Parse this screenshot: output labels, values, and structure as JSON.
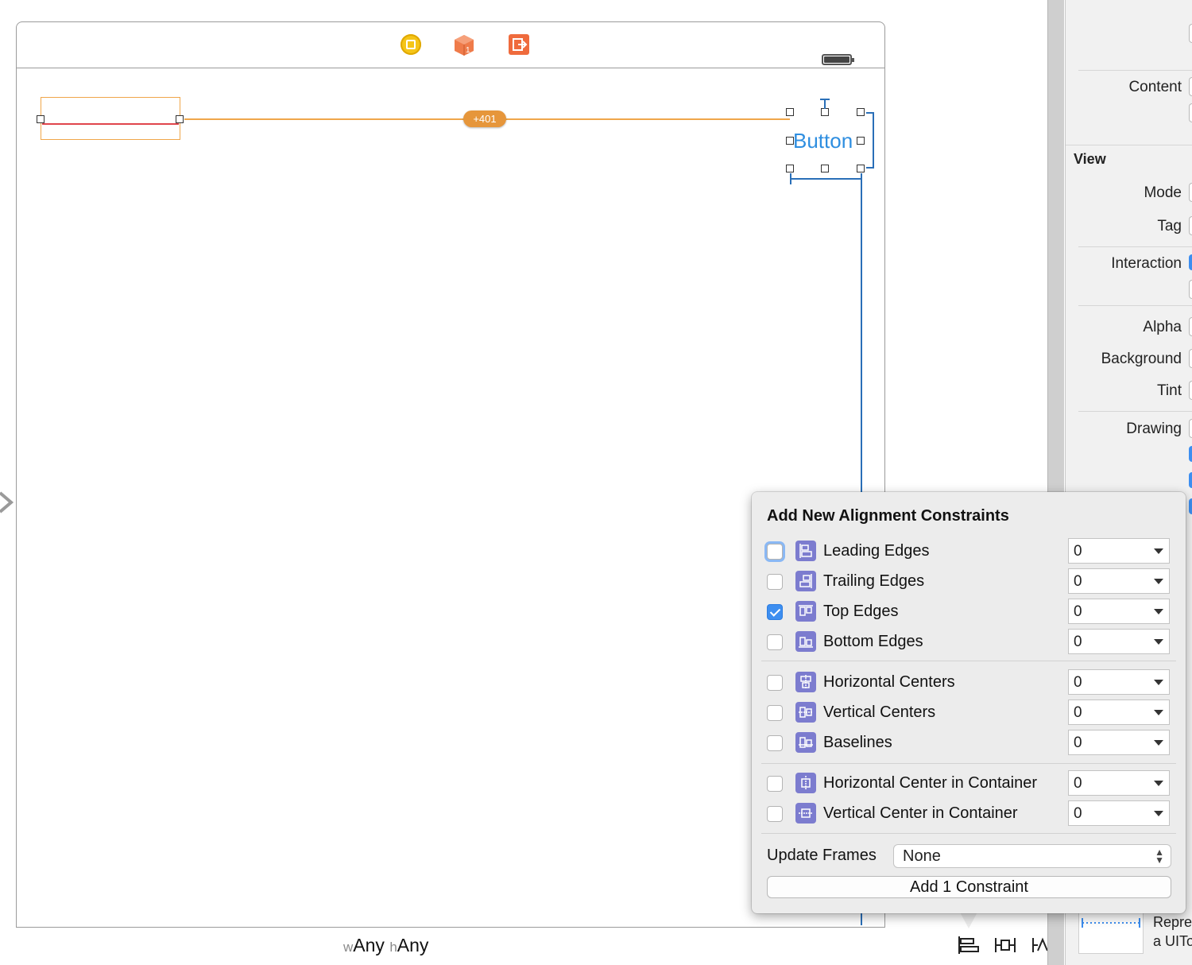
{
  "canvas": {
    "constraint_badge": "+401",
    "button_title": "Button",
    "size_class": {
      "w_prefix": "w",
      "w_value": "Any",
      "h_prefix": "h",
      "h_value": "Any"
    }
  },
  "inspector": {
    "content_label": "Content",
    "view_header": "View",
    "mode_label": "Mode",
    "tag_label": "Tag",
    "interaction_label": "Interaction",
    "alpha_label": "Alpha",
    "background_label": "Background",
    "tint_label": "Tint",
    "drawing_label": "Drawing",
    "library_text_1": "Repre",
    "library_text_2": "a UITo"
  },
  "popover": {
    "title": "Add New Alignment Constraints",
    "rows": [
      {
        "label": "Leading Edges",
        "checked": false,
        "value": "0",
        "icon": "leading-edges-icon"
      },
      {
        "label": "Trailing Edges",
        "checked": false,
        "value": "0",
        "icon": "trailing-edges-icon"
      },
      {
        "label": "Top Edges",
        "checked": true,
        "value": "0",
        "icon": "top-edges-icon"
      },
      {
        "label": "Bottom Edges",
        "checked": false,
        "value": "0",
        "icon": "bottom-edges-icon"
      },
      {
        "label": "Horizontal Centers",
        "checked": false,
        "value": "0",
        "icon": "horizontal-centers-icon"
      },
      {
        "label": "Vertical Centers",
        "checked": false,
        "value": "0",
        "icon": "vertical-centers-icon"
      },
      {
        "label": "Baselines",
        "checked": false,
        "value": "0",
        "icon": "baselines-icon"
      },
      {
        "label": "Horizontal Center in Container",
        "checked": false,
        "value": "0",
        "icon": "horizontal-center-container-icon"
      },
      {
        "label": "Vertical Center in Container",
        "checked": false,
        "value": "0",
        "icon": "vertical-center-container-icon"
      }
    ],
    "update_frames_label": "Update Frames",
    "update_frames_value": "None",
    "add_button": "Add 1 Constraint"
  },
  "colors": {
    "accent_blue": "#3d8ef0",
    "constraint_orange": "#f0a64a",
    "icon_purple": "#7c7ccf"
  }
}
